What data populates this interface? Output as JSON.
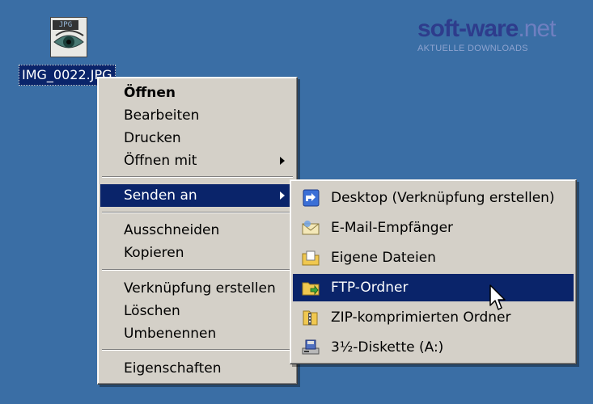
{
  "desktop": {
    "file_icon": {
      "icon": "jpg-file-icon",
      "tag": "JPG",
      "label": "IMG_0022.JPG"
    }
  },
  "watermark": {
    "logo_part1": "soft-ware",
    "logo_part2": ".net",
    "subtitle": "AKTUELLE DOWNLOADS"
  },
  "context_menu": {
    "items": [
      {
        "label": "Öffnen",
        "bold": true
      },
      {
        "label": "Bearbeiten"
      },
      {
        "label": "Drucken"
      },
      {
        "label": "Öffnen mit",
        "submenu": true
      },
      {
        "label": "Senden an",
        "submenu": true,
        "highlighted": true
      },
      {
        "label": "Ausschneiden"
      },
      {
        "label": "Kopieren"
      },
      {
        "label": "Verknüpfung erstellen"
      },
      {
        "label": "Löschen"
      },
      {
        "label": "Umbenennen"
      },
      {
        "label": "Eigenschaften"
      }
    ]
  },
  "send_to_menu": {
    "items": [
      {
        "label": "Desktop (Verknüpfung erstellen)",
        "icon": "desktop-shortcut-icon"
      },
      {
        "label": "E-Mail-Empfänger",
        "icon": "mail-envelope-icon"
      },
      {
        "label": "Eigene Dateien",
        "icon": "my-documents-folder-icon"
      },
      {
        "label": "FTP-Ordner",
        "icon": "ftp-folder-icon",
        "highlighted": true
      },
      {
        "label": "ZIP-komprimierten Ordner",
        "icon": "zip-folder-icon"
      },
      {
        "label": "3½-Diskette (A:)",
        "icon": "floppy-drive-icon"
      }
    ]
  },
  "colors": {
    "desktop_bg": "#3a6ea5",
    "menu_bg": "#d4d0c8",
    "highlight": "#0a246a"
  }
}
